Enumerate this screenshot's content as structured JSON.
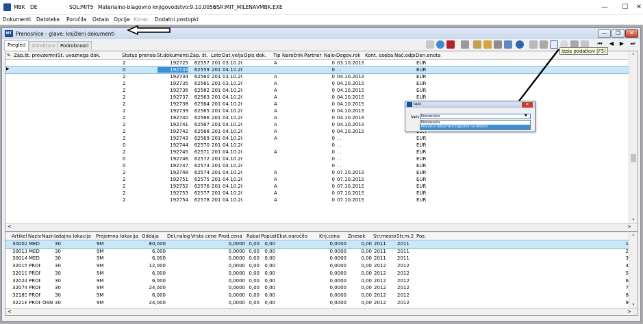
{
  "window": {
    "app_short": "MBK",
    "db": "DE",
    "sql": "SQL:MIT5",
    "app_title": "Materialno-blagovno knjigovodstvo:9.10.0056",
    "user": "USR:MIT_MILENA",
    "exe": "VMBK.EXE"
  },
  "menu": [
    "Dokumenti",
    "Datoteke",
    "Poročila",
    "Ostalo",
    "Opcije",
    "Konec",
    "Dodatni postopki"
  ],
  "menu_disabled": [
    "Konec"
  ],
  "child": {
    "title": "Prenosnice - glave: knjiženi dokumenti"
  },
  "tabs": [
    {
      "label": "Pregled",
      "state": "active"
    },
    {
      "label": "Korekture",
      "state": "disabled"
    },
    {
      "label": "Podrobnosti",
      "state": "normal"
    }
  ],
  "tooltip": "Izpis podatkov [F5]",
  "top_grid": {
    "columns": [
      "Zap.št. prevzemnice",
      "Št. uvoznega dok.",
      "Status prenosa",
      "Št.dokumenta",
      "Zap. št.",
      "Leto",
      "Dat.veljave",
      "Opis dok.",
      "Tip",
      "Naročnik",
      "Partner",
      "Nalog",
      "Dogov.rok",
      "Kont. oseba",
      "Nač.odpr.",
      "Den.enota"
    ],
    "rows": [
      [
        "",
        "",
        "2",
        "192725",
        "62557",
        "2019",
        "03.10.2019",
        "",
        "A",
        "",
        "",
        "0",
        "03.10.2019",
        "",
        "",
        "EUR"
      ],
      [
        "",
        "",
        "0",
        "192733",
        "62559",
        "2019",
        "04.10.2019",
        "",
        "",
        "",
        "",
        "0",
        ". .",
        "",
        "",
        "EUR"
      ],
      [
        "",
        "",
        "2",
        "192734",
        "62560",
        "2019",
        "03.10.2019",
        "",
        "A",
        "",
        "",
        "0",
        "04.10.2019",
        "",
        "",
        "EUR"
      ],
      [
        "",
        "",
        "2",
        "192735",
        "62561",
        "2019",
        "03.10.2019",
        "",
        "A",
        "",
        "",
        "0",
        "04.10.2019",
        "",
        "",
        "EUR"
      ],
      [
        "",
        "",
        "2",
        "192736",
        "62562",
        "2019",
        "04.10.2019",
        "",
        "A",
        "",
        "",
        "0",
        "04.10.2019",
        "",
        "",
        "EUR"
      ],
      [
        "",
        "",
        "2",
        "192737",
        "62563",
        "2019",
        "04.10.2019",
        "",
        "A",
        "",
        "",
        "0",
        "04.10.2019",
        "",
        "",
        "EUR"
      ],
      [
        "",
        "",
        "2",
        "192738",
        "62564",
        "2019",
        "04.10.2019",
        "",
        "A",
        "",
        "",
        "0",
        "04.10.2019",
        "",
        "",
        "EUR"
      ],
      [
        "",
        "",
        "2",
        "192739",
        "62565",
        "2019",
        "04.10.2019",
        "",
        "A",
        "",
        "",
        "0",
        "04.10.2019",
        "",
        "",
        "EUR"
      ],
      [
        "",
        "",
        "2",
        "192740",
        "62566",
        "2019",
        "04.10.2019",
        "",
        "A",
        "",
        "",
        "0",
        "04.10.2019",
        "",
        "",
        "EUR"
      ],
      [
        "",
        "",
        "2",
        "192741",
        "62567",
        "2019",
        "04.10.2019",
        "",
        "A",
        "",
        "",
        "0",
        "04.10.2019",
        "",
        "",
        "EUR"
      ],
      [
        "",
        "",
        "2",
        "192742",
        "62568",
        "2019",
        "04.10.2019",
        "",
        "A",
        "",
        "",
        "0",
        "04.10.2019",
        "",
        "",
        "EUR"
      ],
      [
        "",
        "",
        "2",
        "192743",
        "62569",
        "2019",
        "04.10.2019",
        "",
        "A",
        "",
        "",
        "0",
        ". .",
        "",
        "",
        "EUR"
      ],
      [
        "",
        "",
        "0",
        "192744",
        "62570",
        "2019",
        "04.10.2019",
        "",
        "",
        "",
        "",
        "0",
        ". .",
        "",
        "",
        "EUR"
      ],
      [
        "",
        "",
        "2",
        "192745",
        "62571",
        "2019",
        "04.10.2019",
        "",
        "A",
        "",
        "",
        "0",
        ". .",
        "",
        "",
        "EUR"
      ],
      [
        "",
        "",
        "0",
        "192746",
        "62572",
        "2019",
        "04.10.2019",
        "",
        "",
        "",
        "",
        "0",
        ". .",
        "",
        "",
        "EUR"
      ],
      [
        "",
        "",
        "0",
        "192747",
        "62573",
        "2019",
        "04.10.2019",
        "",
        "",
        "",
        "",
        "0",
        ". .",
        "",
        "",
        "EUR"
      ],
      [
        "",
        "",
        "2",
        "192748",
        "62574",
        "2019",
        "04.10.2019",
        "",
        "A",
        "",
        "",
        "0",
        "07.10.2019",
        "",
        "",
        "EUR"
      ],
      [
        "",
        "",
        "2",
        "192751",
        "62575",
        "2019",
        "04.10.2019",
        "",
        "A",
        "",
        "",
        "0",
        "07.10.2019",
        "",
        "",
        "EUR"
      ],
      [
        "",
        "",
        "2",
        "192752",
        "62576",
        "2019",
        "04.10.2019",
        "",
        "A",
        "",
        "",
        "0",
        "07.10.2019",
        "",
        "",
        "EUR"
      ],
      [
        "",
        "",
        "2",
        "192753",
        "62577",
        "2019",
        "04.10.2019",
        "",
        "A",
        "",
        "",
        "0",
        "07.10.2019",
        "",
        "",
        "EUR"
      ],
      [
        "",
        "",
        "2",
        "192754",
        "62578",
        "2019",
        "04.10.2019",
        "",
        "A",
        "",
        "",
        "0",
        "07.10.2019",
        "",
        "",
        "EUR"
      ]
    ]
  },
  "bottom_grid": {
    "columns": [
      "Artikel",
      "Naziv",
      "Naziv 2",
      "Izdajna lokacija",
      "Prejemna lokacija",
      "Oddaja",
      "Del.nalog",
      "Vrsta cene",
      "Prod.cena",
      "Rabat%",
      "Popust%",
      "Ekst.naročilo",
      "Knj.cena",
      "Znesek",
      "Str.mesto",
      "Str.m.2",
      "Poz."
    ],
    "rows": [
      [
        "30002",
        "MED (",
        "",
        "30",
        "9M",
        "80,000",
        "",
        "",
        "0,0000",
        "0,00",
        "0,00",
        "",
        "0,0000",
        "0,00",
        "2011",
        "2011",
        "1"
      ],
      [
        "30011",
        "MED (",
        "",
        "30",
        "9M",
        "6,000",
        "",
        "",
        "0,0000",
        "0,00",
        "0,00",
        "",
        "0,0000",
        "0,00",
        "2011",
        "2011",
        "2"
      ],
      [
        "30014",
        "MED (",
        "",
        "30",
        "9M",
        "6,000",
        "",
        "",
        "0,0000",
        "0,00",
        "0,00",
        "",
        "0,0000",
        "0,00",
        "2011",
        "2011",
        "3"
      ],
      [
        "32015",
        "PROP",
        "",
        "30",
        "9M",
        "12,000",
        "",
        "",
        "0,0000",
        "0,00",
        "0,00",
        "",
        "0,0000",
        "0,00",
        "2012",
        "2012",
        "4"
      ],
      [
        "32019",
        "PROP",
        "",
        "30",
        "9M",
        "6,000",
        "",
        "",
        "0,0000",
        "0,00",
        "0,00",
        "",
        "0,0000",
        "0,00",
        "2012",
        "2012",
        "5"
      ],
      [
        "32024",
        "PROP",
        "",
        "30",
        "9M",
        "6,000",
        "",
        "",
        "0,0000",
        "0,00",
        "0,00",
        "",
        "0,0000",
        "0,00",
        "2012",
        "2012",
        "6"
      ],
      [
        "32074",
        "PROP",
        "",
        "30",
        "9M",
        "24,000",
        "",
        "",
        "0,0000",
        "0,00",
        "0,00",
        "",
        "0,0000",
        "0,00",
        "2012",
        "2012",
        "7"
      ],
      [
        "32183",
        "PROP",
        "",
        "30",
        "9M",
        "6,000",
        "",
        "",
        "0,0000",
        "0,00",
        "0,00",
        "",
        "0,0000",
        "0,00",
        "2012",
        "2012",
        "8"
      ],
      [
        "32218",
        "PROP",
        "OSNOV",
        "30",
        "9M",
        "24,000",
        "",
        "",
        "0,0000",
        "0,00",
        "0,00",
        "",
        "0,0000",
        "0,00",
        "2012",
        "2012",
        "9"
      ]
    ]
  },
  "popup": {
    "title": "Izpis",
    "label": "Izpis:",
    "selected": "Prenosnica",
    "options": [
      "Prenosnica",
      "Prenosni dokument trgovine na drobno"
    ]
  },
  "colors": {
    "selection_row": "#cbe7f6",
    "selection_cell": "#3b8fd6",
    "annotation": "#000000"
  }
}
